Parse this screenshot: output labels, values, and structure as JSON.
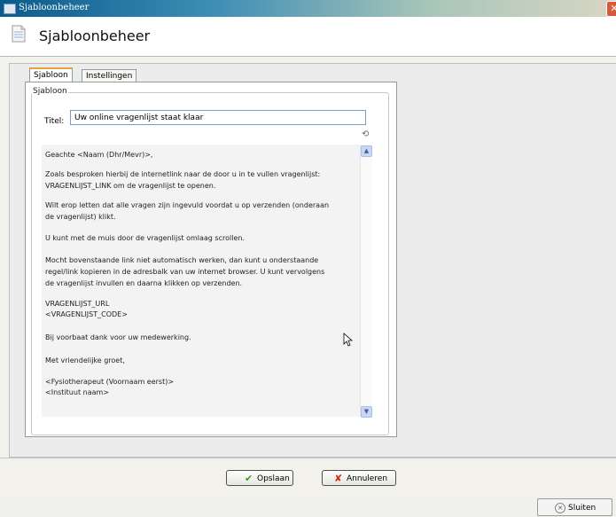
{
  "window": {
    "title": "Sjabloonbeheer",
    "close_glyph": "✕",
    "accent": "#0a5a8c"
  },
  "header": {
    "title": "Sjabloonbeheer",
    "icon": "document-icon"
  },
  "tabs": [
    {
      "label": "Sjabloon",
      "active": true
    },
    {
      "label": "Instellingen",
      "active": false
    }
  ],
  "group": {
    "label": "Sjabloon"
  },
  "titel": {
    "label": "Titel:",
    "value": "Uw online vragenlijst staat klaar"
  },
  "body_lines": [
    "Geachte <Naam (Dhr/Mevr)>,",
    "Zoals besproken hierbij de internetlink naar de door u in te vullen vragenlijst:",
    "VRAGENLIJST_LINK om de vragenlijst te openen.",
    "Wilt erop letten dat alle vragen zijn ingevuld voordat u op verzenden (onderaan",
    "de vragenlijst) klikt.",
    "U kunt met de muis door de vragenlijst omlaag scrollen.",
    "Mocht bovenstaande link niet automatisch werken, dan kunt u onderstaande",
    "regel/link kopieren in de adresbalk van uw internet browser. U kunt vervolgens",
    "de vragenlijst invullen en daarna klikken op verzenden.",
    "VRAGENLIJST_URL",
    "<VRAGENLIJST_CODE>",
    "Bij voorbaat dank voor uw medewerking.",
    "Met vriendelijke groet,",
    "<Fysiotherapeut (Voornaam eerst)>",
    "<Instituut naam>"
  ],
  "buttons": {
    "save": "Opslaan",
    "cancel": "Annuleren",
    "close": "Sluiten"
  },
  "icons": {
    "save": "checkmark-icon",
    "cancel": "x-icon",
    "close": "circle-x-icon"
  }
}
